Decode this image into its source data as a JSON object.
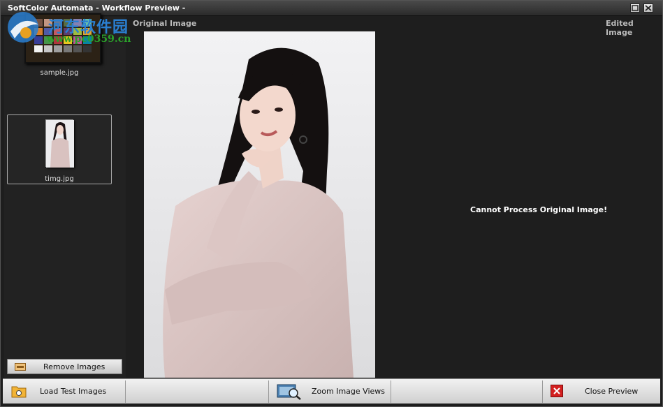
{
  "window": {
    "title": "SoftColor Automata - Workflow Preview -"
  },
  "watermark": {
    "text": "河东软件园",
    "url": "www.pc0359.cn"
  },
  "sidebar": {
    "items": [
      {
        "name": "sample.jpg",
        "selected": false
      },
      {
        "name": "timg.jpg",
        "selected": true
      }
    ],
    "remove_button": "Remove Images"
  },
  "main": {
    "original_label": "Original Image",
    "edited_label": "Edited Image",
    "edited_message": "Cannot Process Original Image!"
  },
  "toolbar": {
    "load_button": "Load Test Images",
    "zoom_button": "Zoom Image Views",
    "close_button": "Close Preview"
  },
  "colors": {
    "background": "#1e1e1e",
    "watermark_blue": "#2a7fd1",
    "watermark_green": "#2aa02a",
    "close_red": "#d32020"
  }
}
